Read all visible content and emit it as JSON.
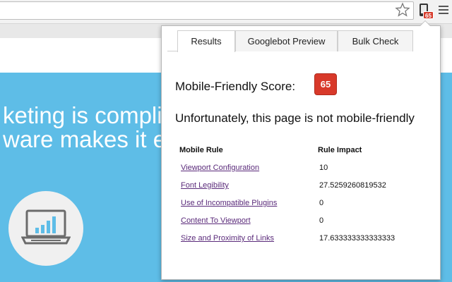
{
  "browser": {
    "extension_badge": "65"
  },
  "background_page": {
    "hero_line1": "keting is complic",
    "hero_line2": "ware makes it ea"
  },
  "popup": {
    "tabs": [
      {
        "label": "Results",
        "active": true
      },
      {
        "label": "Googlebot Preview",
        "active": false
      },
      {
        "label": "Bulk Check",
        "active": false
      }
    ],
    "score_label": "Mobile-Friendly Score:",
    "score_value": "65",
    "verdict": "Unfortunately, this page is not mobile-friendly",
    "table": {
      "col_rule": "Mobile Rule",
      "col_impact": "Rule Impact",
      "rows": [
        {
          "rule": "Viewport Configuration",
          "impact": "10"
        },
        {
          "rule": "Font Legibility",
          "impact": "27.5259260819532"
        },
        {
          "rule": "Use of Incompatible Plugins",
          "impact": "0"
        },
        {
          "rule": "Content To Viewport",
          "impact": "0"
        },
        {
          "rule": "Size and Proximity of Links",
          "impact": "17.633333333333333"
        }
      ]
    }
  },
  "colors": {
    "hero_bg": "#5ebde7",
    "badge_red": "#d8392a",
    "link_purple": "#5a2a7a"
  }
}
